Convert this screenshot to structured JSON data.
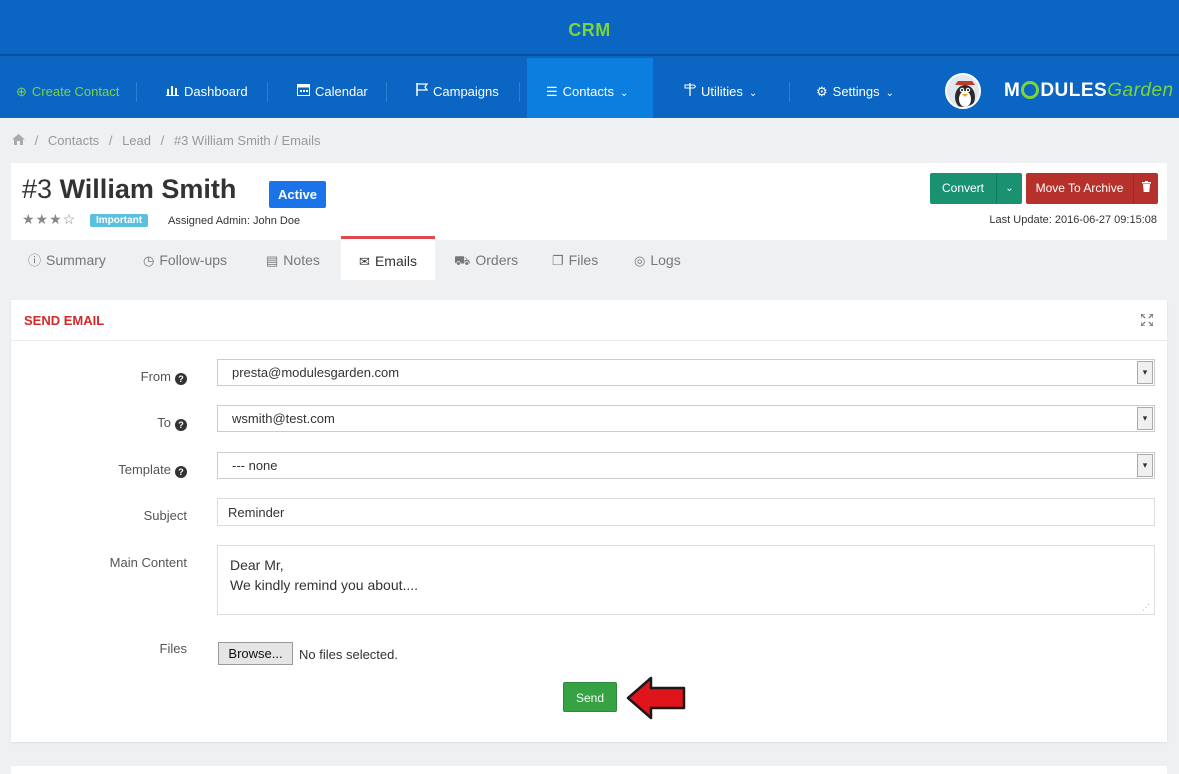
{
  "app": {
    "title": "CRM"
  },
  "nav": {
    "create_contact": "Create Contact",
    "dashboard": "Dashboard",
    "calendar": "Calendar",
    "campaigns": "Campaigns",
    "contacts": "Contacts",
    "utilities": "Utilities",
    "settings": "Settings",
    "logo_main": "M",
    "logo_rest": "DULES",
    "logo_garden": "Garden"
  },
  "breadcrumb": {
    "items": [
      "Contacts",
      "Lead",
      "#3 William Smith / Emails"
    ],
    "separator": "/"
  },
  "contact": {
    "number": "#3",
    "name": "William Smith",
    "status": "Active",
    "stars_filled": 3,
    "stars_total": 4,
    "stars_display": "★★★☆",
    "priority_badge": "Important",
    "assigned": "Assigned Admin: John Doe",
    "last_update": "Last Update: 2016-06-27 09:15:08"
  },
  "actions": {
    "convert": "Convert",
    "archive": "Move To Archive"
  },
  "tabs": [
    "Summary",
    "Follow-ups",
    "Notes",
    "Emails",
    "Orders",
    "Files",
    "Logs"
  ],
  "active_tab": "Emails",
  "email_form": {
    "panel_title": "SEND EMAIL",
    "from_label": "From",
    "from_value": "presta@modulesgarden.com",
    "to_label": "To",
    "to_value": "wsmith@test.com",
    "template_label": "Template",
    "template_value": "--- none",
    "subject_label": "Subject",
    "subject_value": "Reminder",
    "content_label": "Main Content",
    "content_value": "Dear Mr,\nWe kindly remind you about....",
    "files_label": "Files",
    "browse_label": "Browse...",
    "no_files": "No files selected.",
    "send_label": "Send"
  },
  "colors": {
    "header_bg": "#0a66c2",
    "brand_green": "#7cd43a",
    "active_nav": "#0b7ee0",
    "status_blue": "#1a73e8",
    "convert_teal": "#1a9272",
    "archive_red": "#b6302c",
    "send_green": "#36a244",
    "panel_title_red": "#d1292a"
  }
}
